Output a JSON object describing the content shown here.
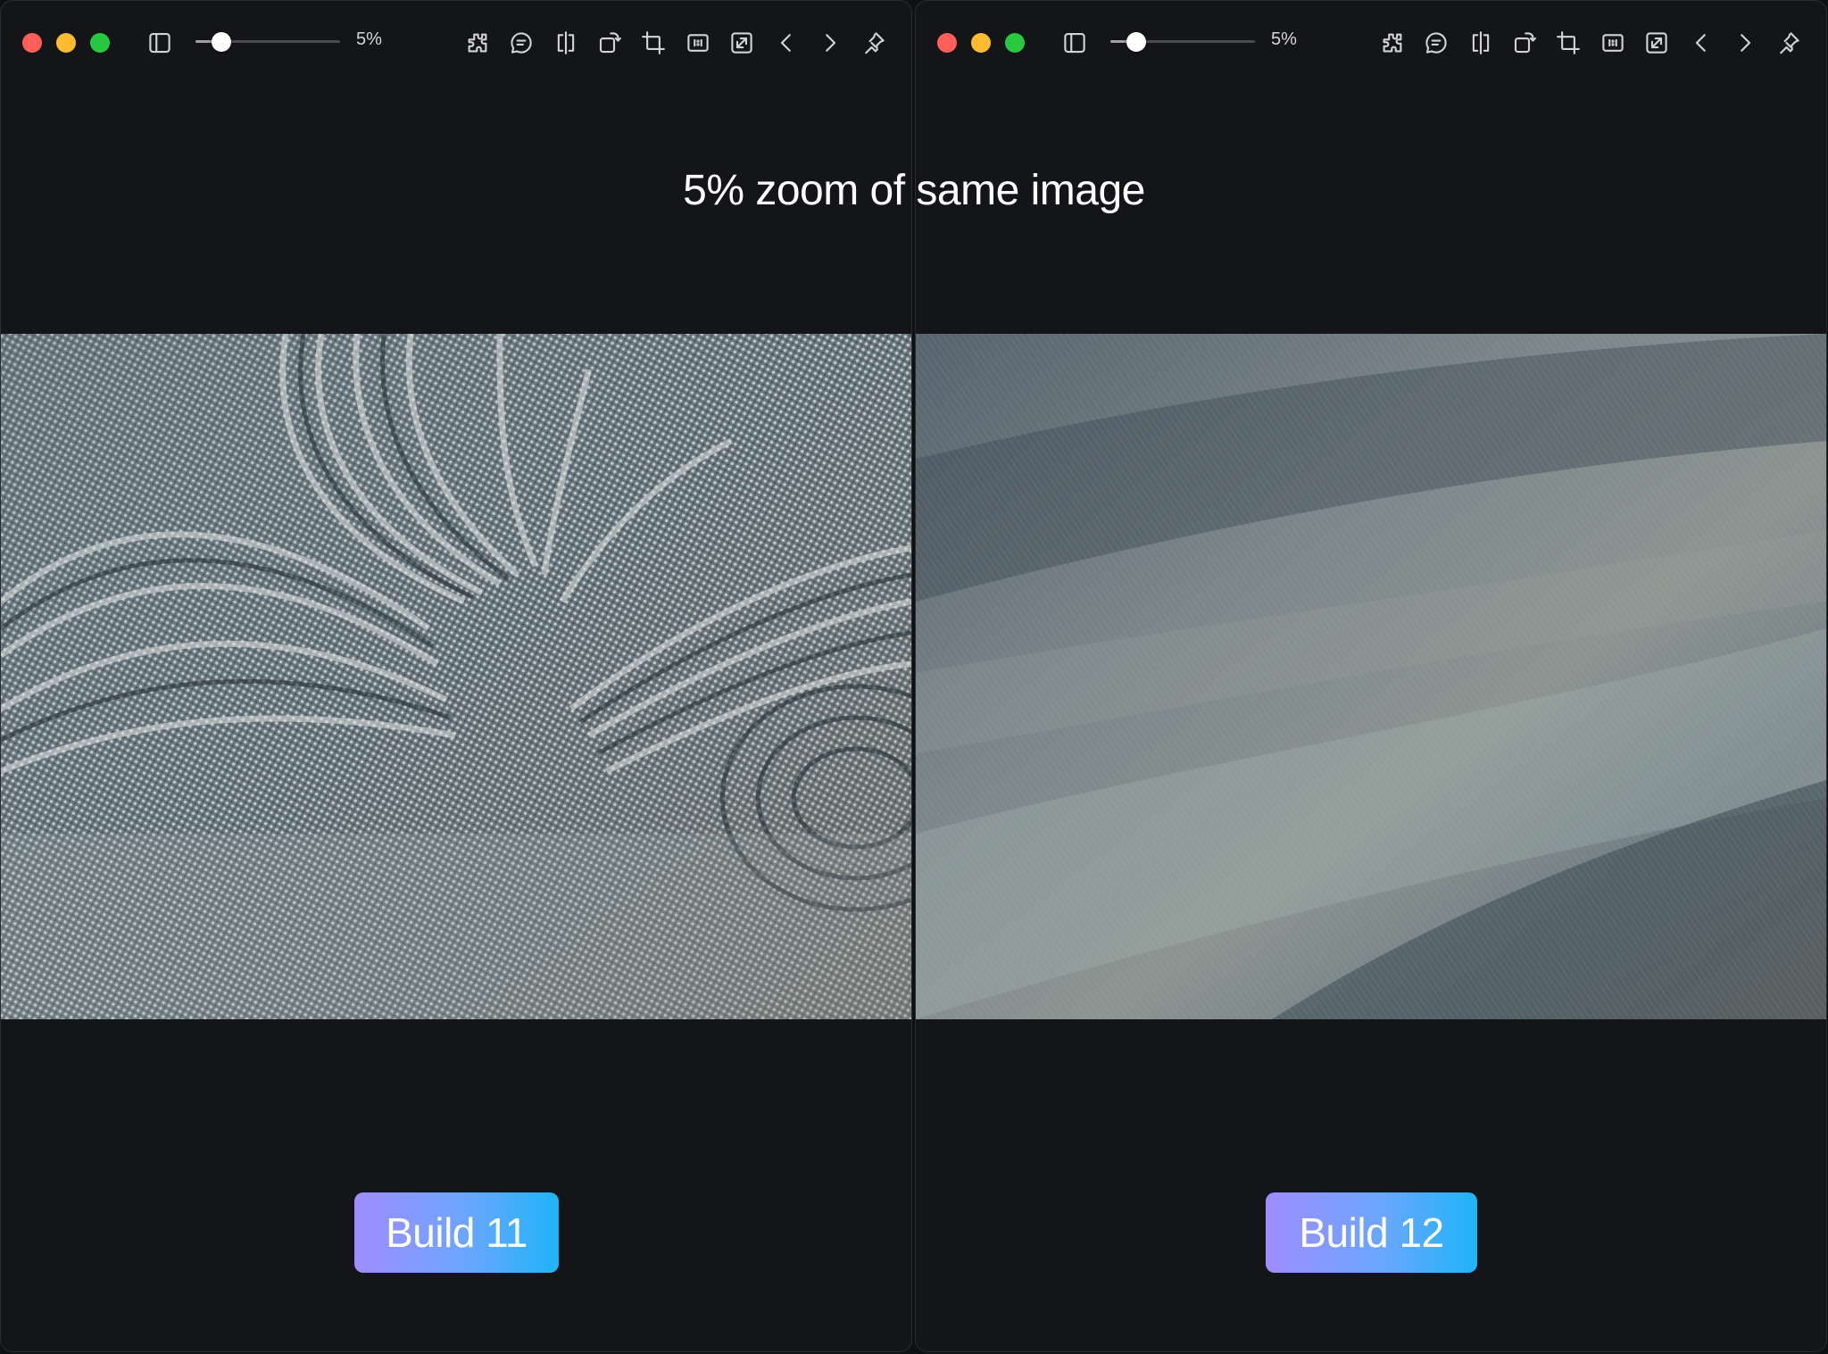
{
  "headline": "5% zoom of same image",
  "colors": {
    "close": "#ff5f57",
    "minimize": "#febc2e",
    "maximize": "#28c840",
    "badge_start": "#a08cff",
    "badge_end": "#1fb4f5"
  },
  "windows": [
    {
      "zoom": {
        "label": "5%",
        "value_percent": 5
      },
      "build_label": "Build 11",
      "image_style": "moire"
    },
    {
      "zoom": {
        "label": "5%",
        "value_percent": 5
      },
      "build_label": "Build 12",
      "image_style": "smooth"
    }
  ],
  "toolbar_icons": [
    "sidebar-icon",
    "extensions-icon",
    "comment-icon",
    "compare-icon",
    "rotate-icon",
    "crop-icon",
    "actual-size-icon",
    "fit-window-icon",
    "previous-icon",
    "next-icon",
    "pin-icon"
  ]
}
